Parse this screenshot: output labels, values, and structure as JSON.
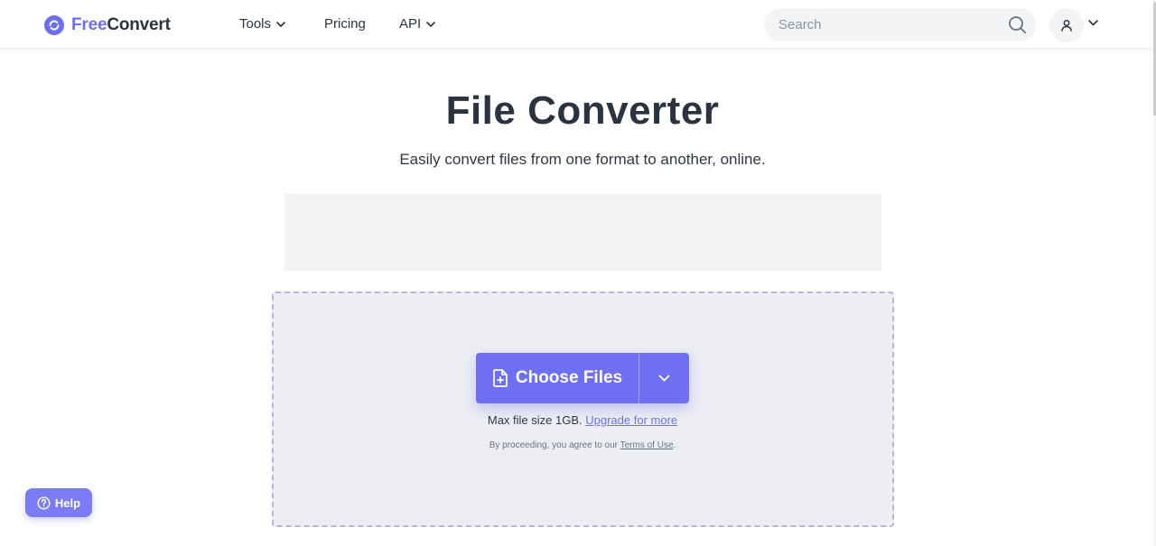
{
  "header": {
    "logo_free": "Free",
    "logo_convert": "Convert",
    "nav": {
      "tools_label": "Tools",
      "pricing_label": "Pricing",
      "api_label": "API"
    },
    "search_placeholder": "Search"
  },
  "hero": {
    "title": "File Converter",
    "subtitle": "Easily convert files from one format to another, online."
  },
  "upload": {
    "choose_label": "Choose Files",
    "max_size_text": "Max file size 1GB.",
    "upgrade_link": "Upgrade for more",
    "terms_prefix": "By proceeding, you agree to our",
    "terms_link": "Terms of Use",
    "terms_suffix": "."
  },
  "help": {
    "label": "Help"
  },
  "colors": {
    "accent": "#6e6ff3",
    "dropzone_bg": "#ededf4",
    "dropzone_border": "#b7b5dd",
    "text": "#2b3340"
  },
  "icons": {
    "logo": "refresh-circle-icon",
    "search": "search-icon",
    "account": "user-icon",
    "file_add": "file-plus-icon",
    "help": "question-circle-icon"
  }
}
